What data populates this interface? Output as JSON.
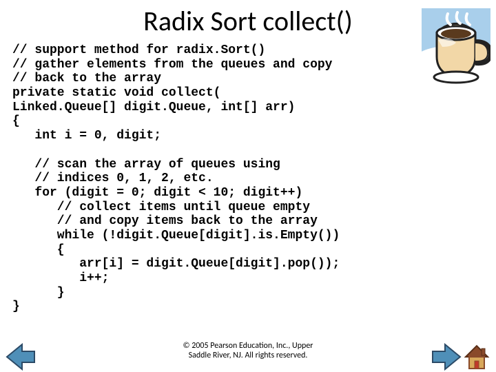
{
  "title": "Radix Sort collect()",
  "code_lines": [
    "// support method for radix.Sort()",
    "// gather elements from the queues and copy",
    "// back to the array",
    "private static void collect(",
    "Linked.Queue[] digit.Queue, int[] arr)",
    "{",
    "   int i = 0, digit;",
    "",
    "   // scan the array of queues using",
    "   // indices 0, 1, 2, etc.",
    "   for (digit = 0; digit < 10; digit++)",
    "      // collect items until queue empty",
    "      // and copy items back to the array",
    "      while (!digit.Queue[digit].is.Empty())",
    "      {",
    "         arr[i] = digit.Queue[digit].pop());",
    "         i++;",
    "      }",
    "}"
  ],
  "footer_line1": "© 2005 Pearson Education, Inc., Upper",
  "footer_line2": "Saddle River, NJ. All rights reserved.",
  "colors": {
    "sky": "#a9cfeb",
    "white_fill": "#ffffff",
    "cup_body": "#f2d7a7",
    "cup_outline": "#222222",
    "arrow_fill": "#4f8fb8",
    "arrow_outline": "#2c4a66",
    "house_roof": "#8a4a2a",
    "house_wall": "#d8a85b",
    "house_door": "#c0392b"
  }
}
